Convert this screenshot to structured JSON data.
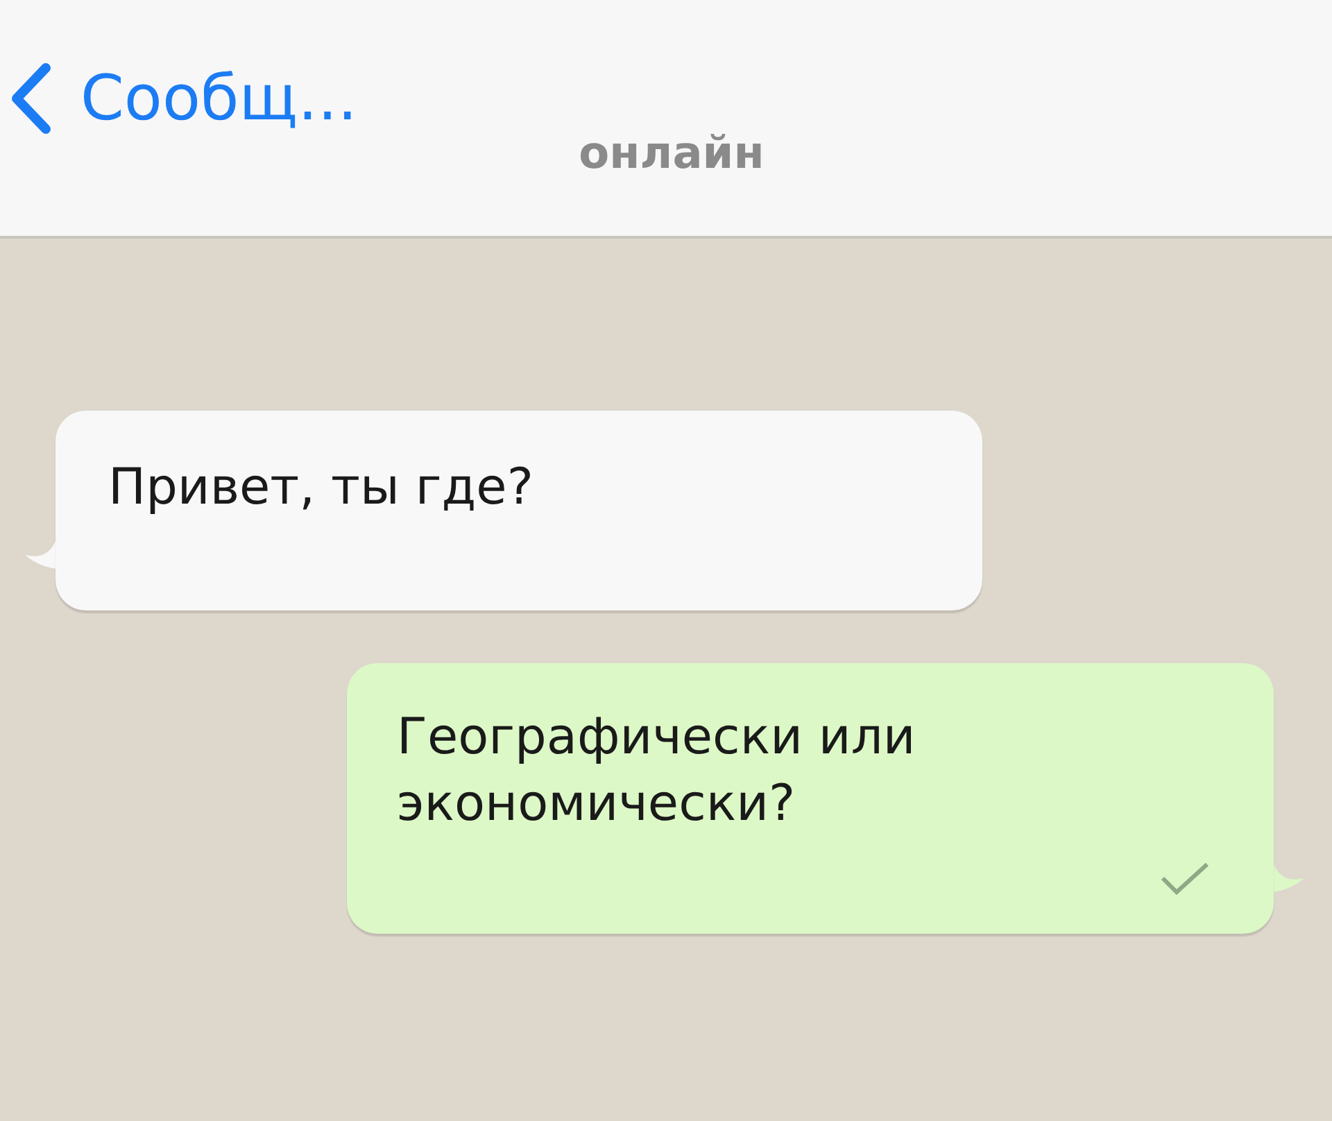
{
  "header": {
    "back_label": "Сообщ...",
    "status": "онлайн"
  },
  "messages": [
    {
      "kind": "incoming",
      "text": "Привет, ты где?"
    },
    {
      "kind": "outgoing",
      "text": "Географически или экономически?",
      "delivered": true
    }
  ]
}
